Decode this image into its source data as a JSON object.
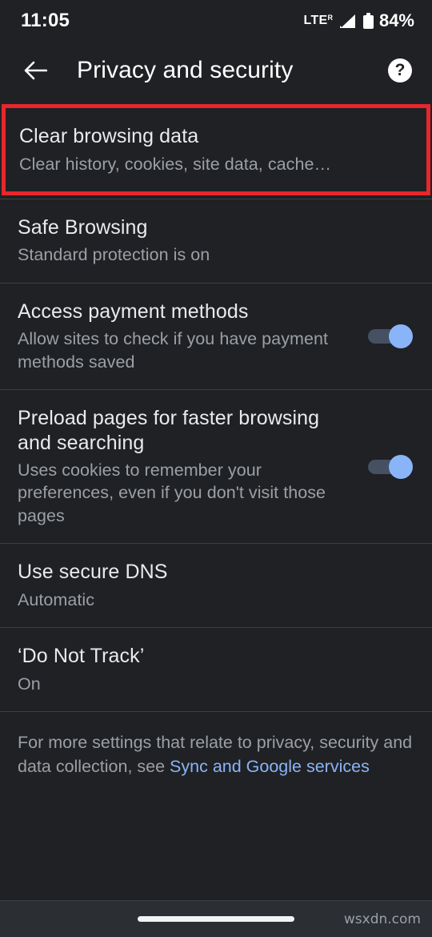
{
  "status_bar": {
    "time": "11:05",
    "network_label": "LTE",
    "network_superscript": "R",
    "battery_percent": "84%",
    "icons": [
      "signal-icon",
      "battery-icon"
    ]
  },
  "toolbar": {
    "back_icon": "back-arrow-icon",
    "title": "Privacy and security",
    "help_icon": "help-circle-icon",
    "help_glyph": "?"
  },
  "settings": {
    "items": [
      {
        "title": "Clear browsing data",
        "subtitle": "Clear history, cookies, site data, cache…",
        "highlighted": true,
        "has_toggle": false
      },
      {
        "title": "Safe Browsing",
        "subtitle": "Standard protection is on",
        "highlighted": false,
        "has_toggle": false
      },
      {
        "title": "Access payment methods",
        "subtitle": "Allow sites to check if you have payment methods saved",
        "highlighted": false,
        "has_toggle": true,
        "toggle_state": "on"
      },
      {
        "title": "Preload pages for faster browsing and searching",
        "subtitle": "Uses cookies to remember your preferences, even if you don't visit those pages",
        "highlighted": false,
        "has_toggle": true,
        "toggle_state": "on"
      },
      {
        "title": "Use secure DNS",
        "subtitle": "Automatic",
        "highlighted": false,
        "has_toggle": false
      },
      {
        "title": "‘Do Not Track’",
        "subtitle": "On",
        "highlighted": false,
        "has_toggle": false
      }
    ]
  },
  "footer": {
    "text_before_link": "For more settings that relate to privacy, security and data collection, see ",
    "link_text": "Sync and Google services"
  },
  "nav_bar": {
    "gesture_pill": "home-gesture-pill",
    "watermark": "wsxdn.com"
  },
  "colors": {
    "background": "#202124",
    "title_text": "#e8eaed",
    "secondary_text": "#9aa0a6",
    "accent_blue": "#8ab4f8",
    "highlight_red": "#e8262c",
    "divider": "#3c4043"
  }
}
